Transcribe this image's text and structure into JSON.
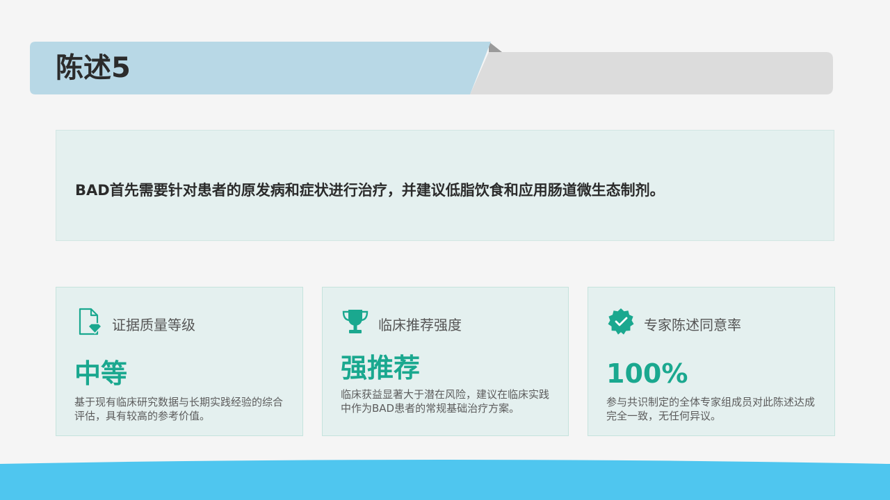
{
  "header": {
    "title": "陈述5"
  },
  "statement": {
    "text": "BAD首先需要针对患者的原发病和症状进行治疗，并建议低脂饮食和应用肠道微生态制剂。"
  },
  "cards": [
    {
      "icon": "document-diamond-icon",
      "title": "证据质量等级",
      "value": "中等",
      "description": "基于现有临床研究数据与长期实践经验的综合评估，具有较高的参考价值。"
    },
    {
      "icon": "trophy-icon",
      "title": "临床推荐强度",
      "value": "强推荐",
      "description": "临床获益显著大于潜在风险，建议在临床实践中作为BAD患者的常规基础治疗方案。"
    },
    {
      "icon": "verified-badge-icon",
      "title": "专家陈述同意率",
      "value": "100%",
      "description": "参与共识制定的全体专家组成员对此陈述达成完全一致，无任何异议。"
    }
  ],
  "colors": {
    "accent": "#1aa88f",
    "banner_blue": "#b8d8e6",
    "banner_gray": "#dcdcdc",
    "footer_blue": "#4fc6ef"
  }
}
